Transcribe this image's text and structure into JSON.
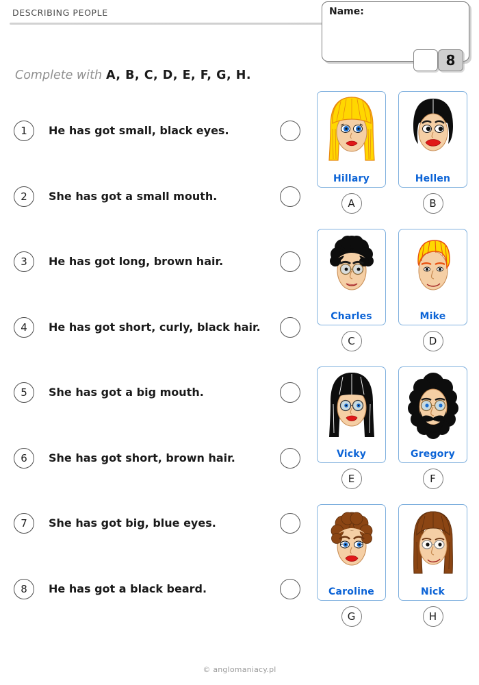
{
  "header": {
    "title": "DESCRIBING PEOPLE",
    "name_label": "Name:",
    "score_blank": "",
    "score_total": "8"
  },
  "instruction": {
    "lead": "Complete with",
    "letters": "A, B, C, D, E, F, G, H."
  },
  "questions": [
    {
      "number": "1",
      "text": "He has got small, black eyes."
    },
    {
      "number": "2",
      "text": "She has got a small mouth."
    },
    {
      "number": "3",
      "text": "He has got long, brown hair."
    },
    {
      "number": "4",
      "text": "He has got short, curly, black hair."
    },
    {
      "number": "5",
      "text": "She has got a big mouth."
    },
    {
      "number": "6",
      "text": "She has got short, brown hair."
    },
    {
      "number": "7",
      "text": "She has got big, blue eyes."
    },
    {
      "number": "8",
      "text": "He has got a black beard."
    }
  ],
  "cards": [
    {
      "letter": "A",
      "name": "Hillary",
      "face": "long-blonde-hair-blue-eyes-face"
    },
    {
      "letter": "B",
      "name": "Hellen",
      "face": "short-black-bob-hair-face"
    },
    {
      "letter": "C",
      "name": "Charles",
      "face": "curly-black-hair-glasses-face"
    },
    {
      "letter": "D",
      "name": "Mike",
      "face": "short-blonde-hair-face"
    },
    {
      "letter": "E",
      "name": "Vicky",
      "face": "long-black-hair-glasses-face"
    },
    {
      "letter": "F",
      "name": "Gregory",
      "face": "black-beard-moustache-glasses-face"
    },
    {
      "letter": "G",
      "name": "Caroline",
      "face": "short-curly-brown-hair-face"
    },
    {
      "letter": "H",
      "name": "Nick",
      "face": "long-brown-hair-glasses-face"
    }
  ],
  "colors": {
    "card_border": "#7fb0de",
    "card_name": "#0b63d6",
    "title": "#4a4a4a",
    "skin": "#f5cfa5",
    "blonde": "#ffd700",
    "black_hair": "#0d0d0d",
    "brown_hair": "#8b4513",
    "lips_red": "#e01818",
    "eye_blue": "#1c6fd0"
  },
  "footer": {
    "copyright": "© anglomaniacy.pl"
  }
}
